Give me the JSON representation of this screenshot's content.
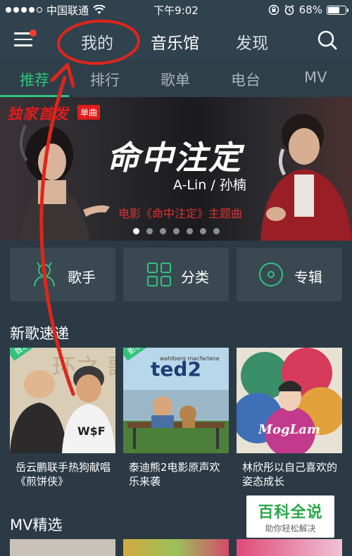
{
  "status_bar": {
    "carrier": "中国联通",
    "time": "下午9:02",
    "battery": "68%",
    "battery_level": 0.68
  },
  "top_nav": {
    "menu_icon": "hamburger-menu-icon",
    "tabs": [
      "我的",
      "音乐馆",
      "发现"
    ],
    "active_tab": "音乐馆",
    "search_icon": "search-icon"
  },
  "sub_tabs": {
    "items": [
      "推荐",
      "排行",
      "歌单",
      "电台",
      "MV"
    ],
    "active": "推荐"
  },
  "banner": {
    "exclusive_label": "独家首发",
    "single_tag": "单曲",
    "title": "命中注定",
    "artists": "A-Lin / 孙楠",
    "subtitle": "电影《命中注定》主题曲",
    "page_count": 7,
    "current_page": 1
  },
  "categories": [
    {
      "label": "歌手",
      "icon": "singer-icon"
    },
    {
      "label": "分类",
      "icon": "grid-icon"
    },
    {
      "label": "专辑",
      "icon": "disc-icon"
    }
  ],
  "new_songs": {
    "title": "新歌速递",
    "items": [
      {
        "tag": "首发",
        "title": "岳云鹏联手热狗献唱《煎饼侠》"
      },
      {
        "tag": "影视",
        "title": "泰迪熊2电影原声欢乐来袭",
        "cover_text": "ted2"
      },
      {
        "tag": "",
        "title": "林欣彤以自己喜欢的姿态成长",
        "cover_text": "MogLam"
      }
    ]
  },
  "mv_section": {
    "title": "MV精选"
  },
  "watermark": {
    "title": "百科全说",
    "subtitle": "助你轻松解决"
  },
  "colors": {
    "accent": "#31c27c",
    "background": "#2b3a45",
    "annotation": "#e0251b"
  }
}
